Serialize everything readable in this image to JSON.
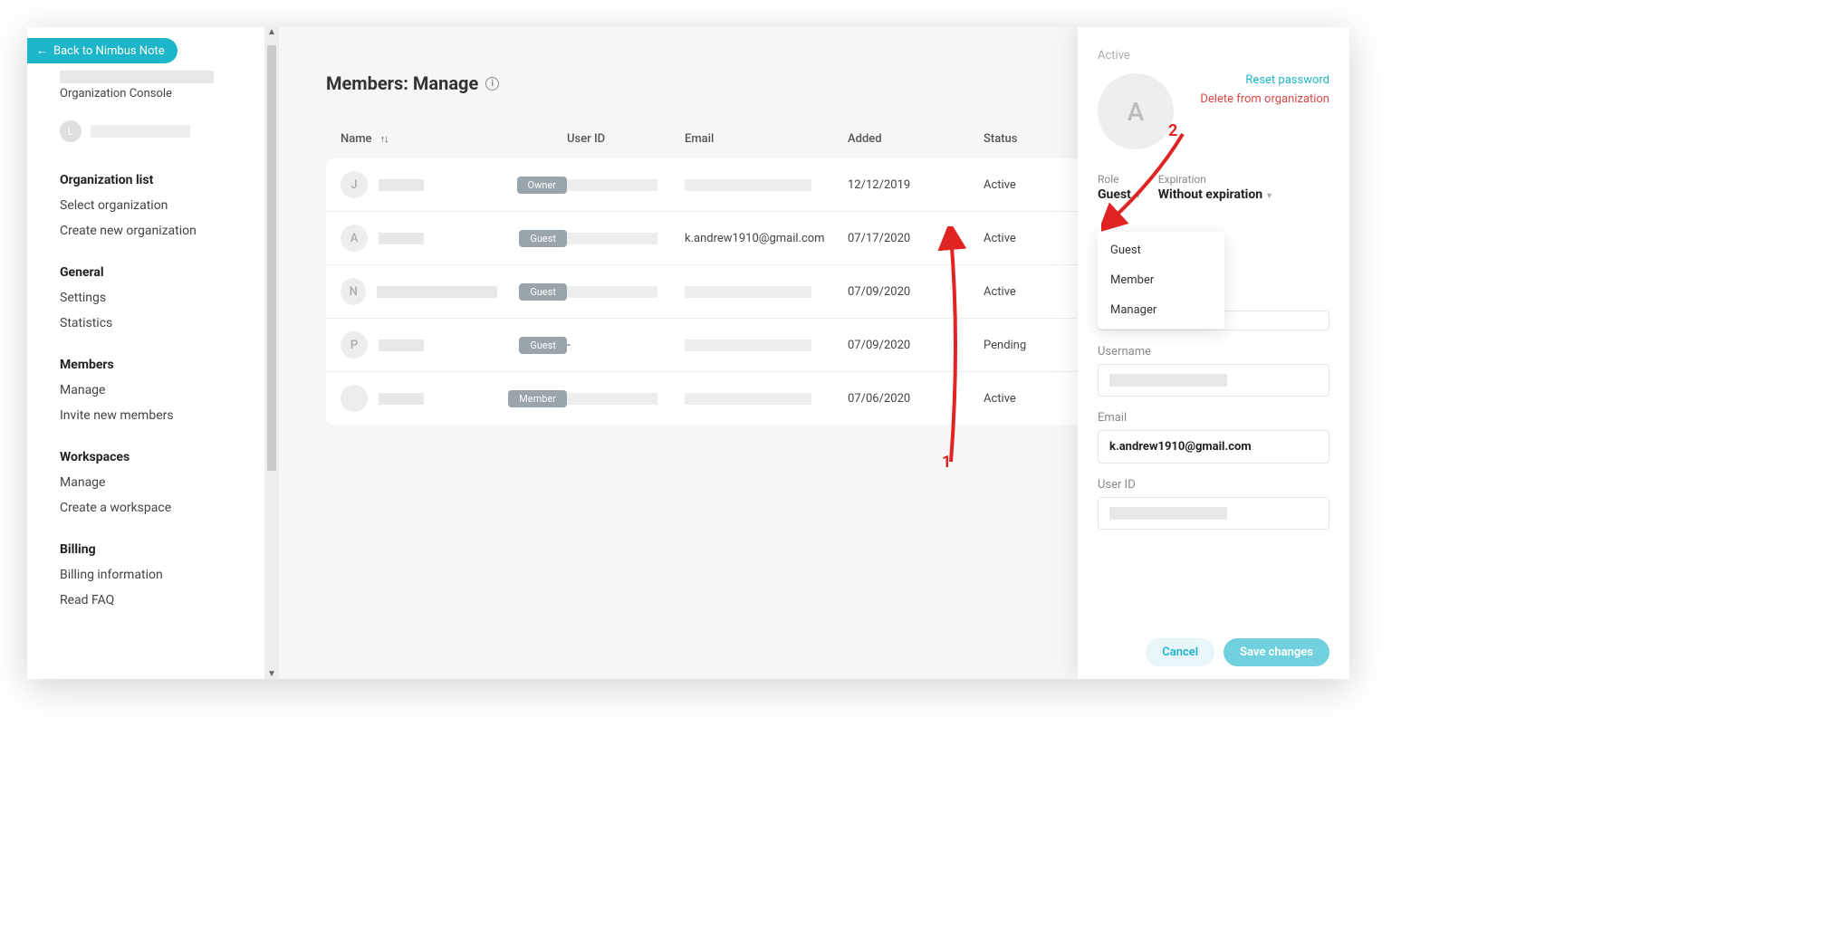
{
  "back_button": "Back to Nimbus Note",
  "org_sub": "Organization Console",
  "user_avatar_initial": "L",
  "sidebar": {
    "groups": [
      {
        "title": "Organization list",
        "items": [
          "Select organization",
          "Create new organization"
        ]
      },
      {
        "title": "General",
        "items": [
          "Settings",
          "Statistics"
        ]
      },
      {
        "title": "Members",
        "items": [
          "Manage",
          "Invite new members"
        ]
      },
      {
        "title": "Workspaces",
        "items": [
          "Manage",
          "Create a workspace"
        ]
      },
      {
        "title": "Billing",
        "items": [
          "Billing information",
          "Read FAQ"
        ]
      }
    ]
  },
  "page_title": "Members: Manage",
  "columns": {
    "name": "Name",
    "user_id": "User ID",
    "email": "Email",
    "added": "Added",
    "status": "Status"
  },
  "rows": [
    {
      "initial": "J",
      "role": "Owner",
      "userid_redacted": true,
      "email_redacted": true,
      "email": "",
      "added": "12/12/2019",
      "status": "Active"
    },
    {
      "initial": "A",
      "role": "Guest",
      "userid_redacted": true,
      "email_redacted": false,
      "email": "k.andrew1910@gmail.com",
      "added": "07/17/2020",
      "status": "Active"
    },
    {
      "initial": "N",
      "role": "Guest",
      "userid_redacted": true,
      "email_redacted": true,
      "email": "",
      "added": "07/09/2020",
      "status": "Active"
    },
    {
      "initial": "P",
      "role": "Guest",
      "userid": "-",
      "email_redacted": true,
      "email": "",
      "added": "07/09/2020",
      "status": "Pending"
    },
    {
      "initial": "",
      "role": "Member",
      "userid_redacted": true,
      "email_redacted": true,
      "email": "",
      "added": "07/06/2020",
      "status": "Active"
    }
  ],
  "panel": {
    "status": "Active",
    "avatar_initial": "A",
    "reset_password": "Reset password",
    "delete": "Delete from organization",
    "role_label": "Role",
    "role_value": "Guest",
    "expiration_label": "Expiration",
    "expiration_value": "Without expiration",
    "dropdown": [
      "Guest",
      "Member",
      "Manager"
    ],
    "username_label": "Username",
    "email_label": "Email",
    "email_value": "k.andrew1910@gmail.com",
    "user_id_label": "User ID",
    "cancel": "Cancel",
    "save": "Save changes"
  },
  "annotations": {
    "label1": "1",
    "label2": "2"
  }
}
